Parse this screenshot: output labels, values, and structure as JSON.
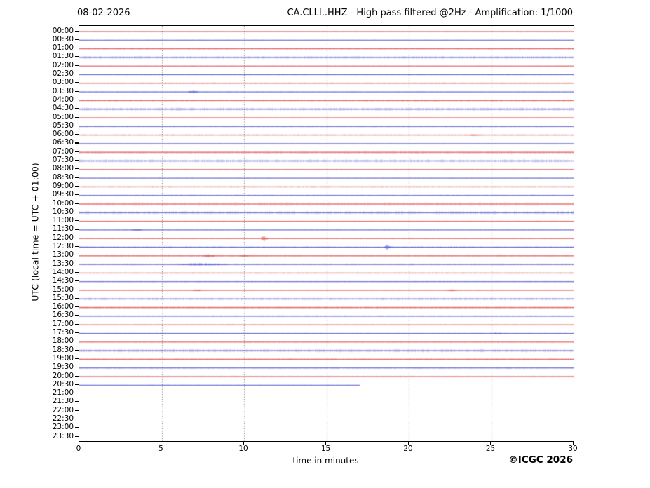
{
  "header": {
    "date": "08-02-2026",
    "title": "CA.CLLI..HHZ - High pass filtered @2Hz - Amplification: 1/1000"
  },
  "axes": {
    "xlabel": "time in minutes",
    "ylabel": "UTC (local time = UTC + 01:00)"
  },
  "footer": {
    "copyright": "©ICGC 2026"
  },
  "chart_data": {
    "type": "line",
    "subtype": "helicorder-seismogram",
    "title": "CA.CLLI..HHZ - High pass filtered @2Hz - Amplification: 1/1000",
    "date": "08-02-2026",
    "xlabel": "time in minutes",
    "ylabel": "UTC (local time = UTC + 01:00)",
    "xlim": [
      0,
      30
    ],
    "x_ticks": [
      0,
      5,
      10,
      15,
      20,
      25,
      30
    ],
    "minutes_per_line": 30,
    "grid": {
      "vertical_dotted_every_min": 5,
      "color": "#707070"
    },
    "trace_colors": {
      "red": "#e05555",
      "blue": "#5a5ad0"
    },
    "frame_color": "#000000",
    "rows": [
      {
        "label": "00:00",
        "color": "red",
        "noise": 0.9,
        "end_min": 30
      },
      {
        "label": "00:30",
        "color": "blue",
        "noise": 0.7,
        "end_min": 30
      },
      {
        "label": "01:00",
        "color": "red",
        "noise": 1.4,
        "end_min": 30
      },
      {
        "label": "01:30",
        "color": "blue",
        "noise": 1.6,
        "end_min": 30
      },
      {
        "label": "02:00",
        "color": "red",
        "noise": 0.8,
        "end_min": 30
      },
      {
        "label": "02:30",
        "color": "blue",
        "noise": 0.8,
        "end_min": 30
      },
      {
        "label": "03:00",
        "color": "red",
        "noise": 1.0,
        "end_min": 30
      },
      {
        "label": "03:30",
        "color": "blue",
        "noise": 0.8,
        "end_min": 30
      },
      {
        "label": "04:00",
        "color": "red",
        "noise": 1.3,
        "end_min": 30
      },
      {
        "label": "04:30",
        "color": "blue",
        "noise": 1.8,
        "end_min": 30
      },
      {
        "label": "05:00",
        "color": "red",
        "noise": 0.8,
        "end_min": 30
      },
      {
        "label": "05:30",
        "color": "blue",
        "noise": 1.0,
        "end_min": 30
      },
      {
        "label": "06:00",
        "color": "red",
        "noise": 1.0,
        "end_min": 30
      },
      {
        "label": "06:30",
        "color": "blue",
        "noise": 0.8,
        "end_min": 30
      },
      {
        "label": "07:00",
        "color": "red",
        "noise": 2.0,
        "end_min": 30
      },
      {
        "label": "07:30",
        "color": "blue",
        "noise": 1.8,
        "end_min": 30
      },
      {
        "label": "08:00",
        "color": "red",
        "noise": 0.8,
        "end_min": 30
      },
      {
        "label": "08:30",
        "color": "blue",
        "noise": 0.8,
        "end_min": 30
      },
      {
        "label": "09:00",
        "color": "red",
        "noise": 1.0,
        "end_min": 30
      },
      {
        "label": "09:30",
        "color": "blue",
        "noise": 1.1,
        "end_min": 30
      },
      {
        "label": "10:00",
        "color": "red",
        "noise": 2.2,
        "end_min": 30
      },
      {
        "label": "10:30",
        "color": "blue",
        "noise": 1.8,
        "end_min": 30
      },
      {
        "label": "11:00",
        "color": "red",
        "noise": 0.8,
        "end_min": 30
      },
      {
        "label": "11:30",
        "color": "blue",
        "noise": 0.8,
        "end_min": 30
      },
      {
        "label": "12:00",
        "color": "red",
        "noise": 0.9,
        "end_min": 30
      },
      {
        "label": "12:30",
        "color": "blue",
        "noise": 1.2,
        "end_min": 30
      },
      {
        "label": "13:00",
        "color": "red",
        "noise": 1.8,
        "end_min": 30
      },
      {
        "label": "13:30",
        "color": "blue",
        "noise": 1.3,
        "end_min": 30
      },
      {
        "label": "14:00",
        "color": "red",
        "noise": 0.9,
        "end_min": 30
      },
      {
        "label": "14:30",
        "color": "blue",
        "noise": 0.8,
        "end_min": 30
      },
      {
        "label": "15:00",
        "color": "red",
        "noise": 0.8,
        "end_min": 30
      },
      {
        "label": "15:30",
        "color": "blue",
        "noise": 1.4,
        "end_min": 30
      },
      {
        "label": "16:00",
        "color": "red",
        "noise": 1.8,
        "end_min": 30
      },
      {
        "label": "16:30",
        "color": "blue",
        "noise": 1.0,
        "end_min": 30
      },
      {
        "label": "17:00",
        "color": "red",
        "noise": 0.8,
        "end_min": 30
      },
      {
        "label": "17:30",
        "color": "blue",
        "noise": 0.8,
        "end_min": 30
      },
      {
        "label": "18:00",
        "color": "red",
        "noise": 1.0,
        "end_min": 30
      },
      {
        "label": "18:30",
        "color": "blue",
        "noise": 1.8,
        "end_min": 30
      },
      {
        "label": "19:00",
        "color": "red",
        "noise": 1.4,
        "end_min": 30
      },
      {
        "label": "19:30",
        "color": "blue",
        "noise": 1.2,
        "end_min": 30
      },
      {
        "label": "20:00",
        "color": "red",
        "noise": 1.0,
        "end_min": 30
      },
      {
        "label": "20:30",
        "color": "blue",
        "noise": 0.6,
        "end_min": 17
      },
      {
        "label": "21:00",
        "color": "red",
        "noise": 0,
        "end_min": 0
      },
      {
        "label": "21:30",
        "color": "blue",
        "noise": 0,
        "end_min": 0
      },
      {
        "label": "22:00",
        "color": "red",
        "noise": 0,
        "end_min": 0
      },
      {
        "label": "22:30",
        "color": "blue",
        "noise": 0,
        "end_min": 0
      },
      {
        "label": "23:00",
        "color": "red",
        "noise": 0,
        "end_min": 0
      },
      {
        "label": "23:30",
        "color": "blue",
        "noise": 0,
        "end_min": 0
      }
    ],
    "events": [
      {
        "row": "03:30",
        "start_min": 6.6,
        "end_min": 7.2,
        "amp": 1.8
      },
      {
        "row": "06:00",
        "start_min": 23.6,
        "end_min": 24.2,
        "amp": 1.6
      },
      {
        "row": "11:30",
        "start_min": 3.2,
        "end_min": 3.8,
        "amp": 1.6
      },
      {
        "row": "12:00",
        "start_min": 11.0,
        "end_min": 11.4,
        "amp": 3.5
      },
      {
        "row": "12:30",
        "start_min": 18.5,
        "end_min": 18.9,
        "amp": 3.2
      },
      {
        "row": "13:00",
        "start_min": 7.5,
        "end_min": 8.2,
        "amp": 2.6
      },
      {
        "row": "13:00",
        "start_min": 9.7,
        "end_min": 10.3,
        "amp": 2.2
      },
      {
        "row": "13:30",
        "start_min": 6.0,
        "end_min": 9.0,
        "amp": 1.8
      },
      {
        "row": "15:00",
        "start_min": 6.9,
        "end_min": 7.4,
        "amp": 1.6
      },
      {
        "row": "15:00",
        "start_min": 22.3,
        "end_min": 22.9,
        "amp": 1.6
      },
      {
        "row": "17:30",
        "start_min": 25.1,
        "end_min": 25.6,
        "amp": 1.4
      }
    ]
  }
}
